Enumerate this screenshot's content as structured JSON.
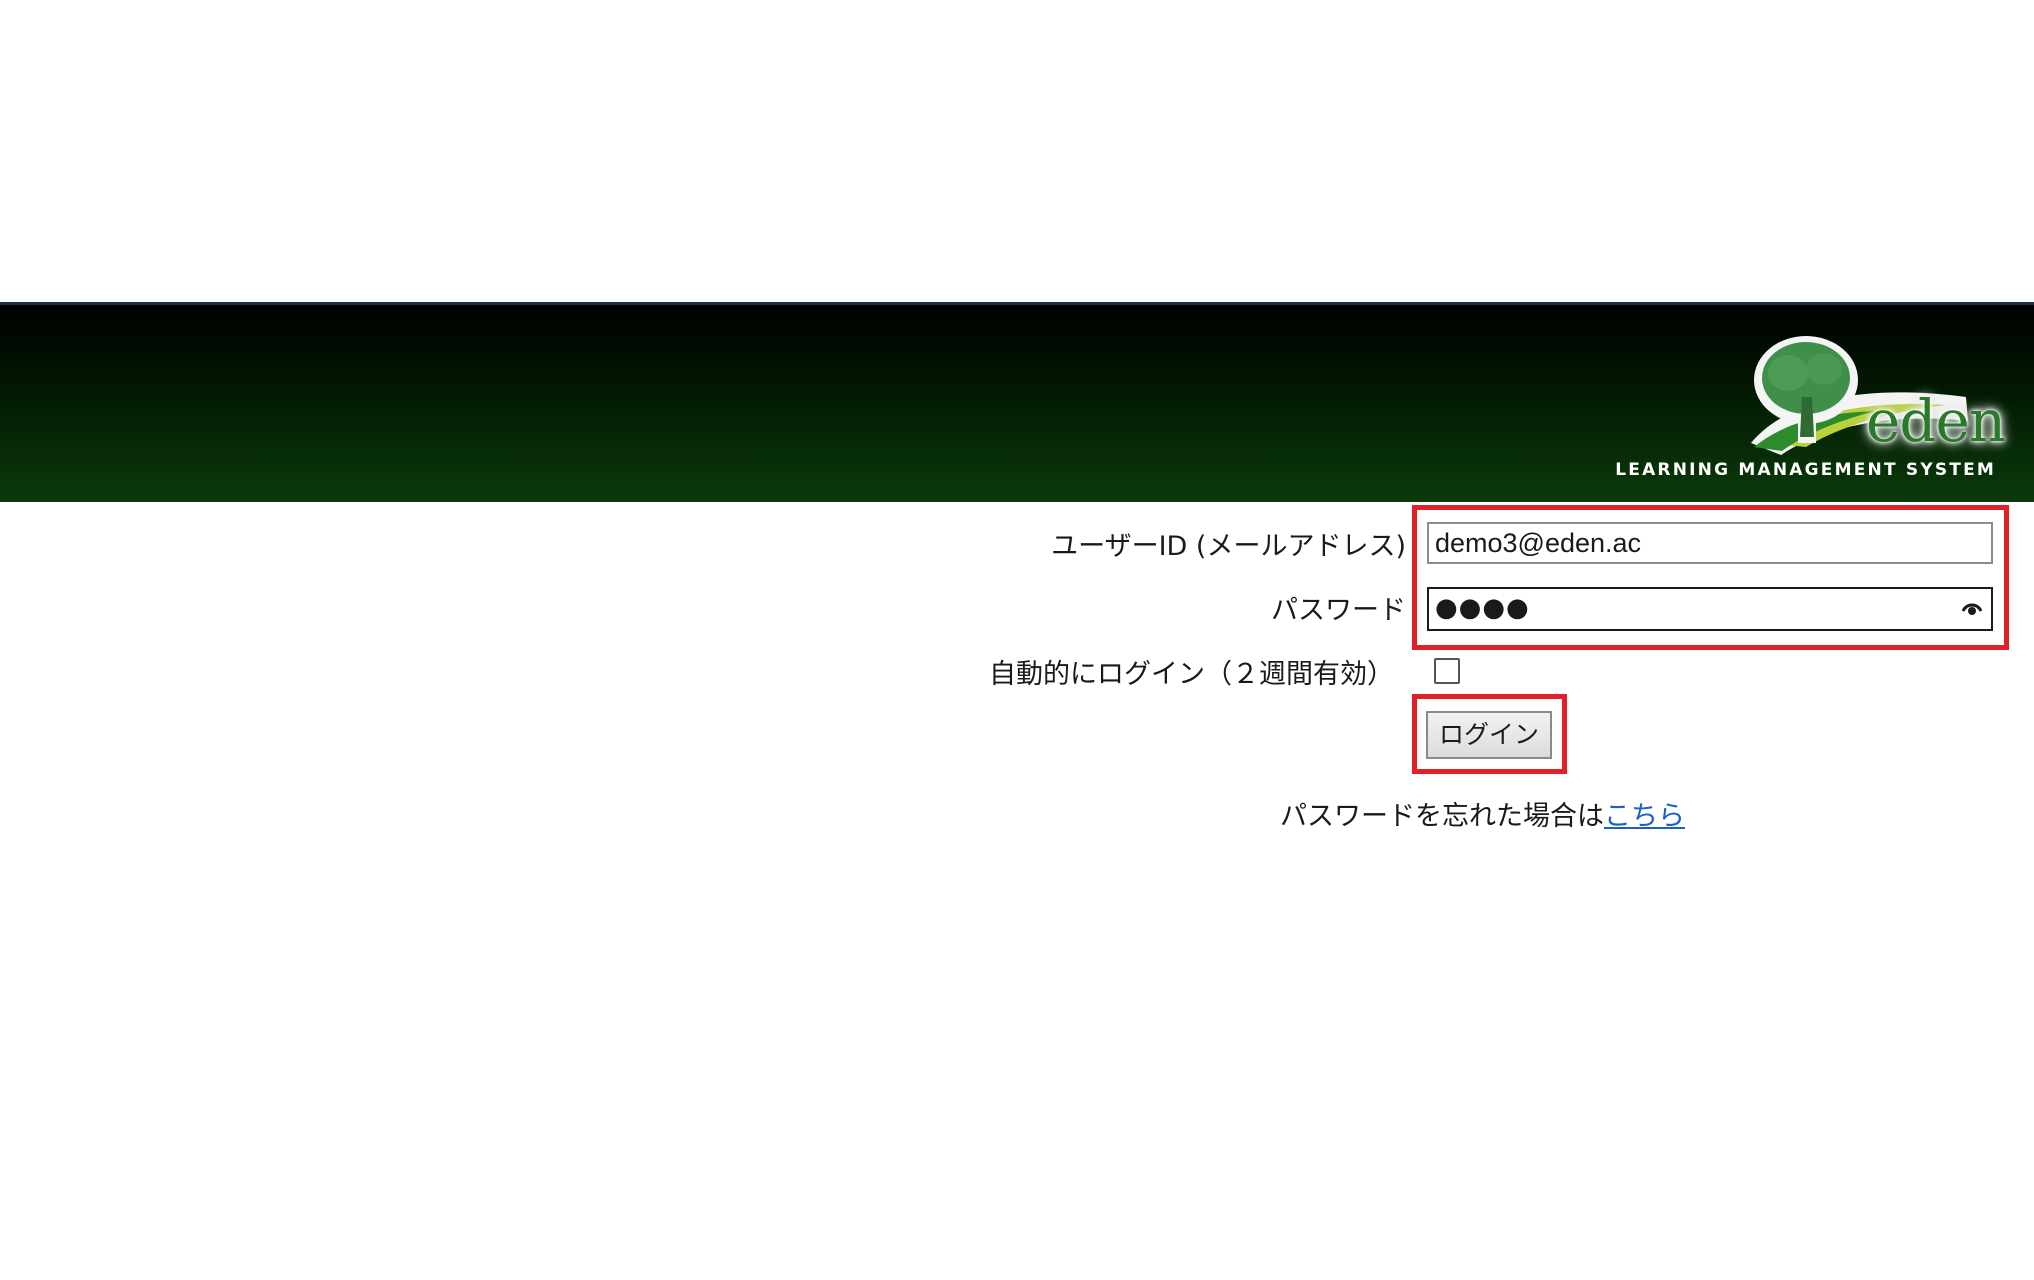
{
  "brand": {
    "logo_word": "eden",
    "tagline": "LEARNING MANAGEMENT SYSTEM",
    "colors": {
      "banner_dark": "#000000",
      "banner_green": "#0b3a0b",
      "logo_green": "#2b7a2b",
      "highlight_red": "#e0202a",
      "link_blue": "#1a5fd0"
    }
  },
  "login_form": {
    "user_id_label": "ユーザーID (メールアドレス)",
    "user_id_value": "demo3@eden.ac",
    "password_label": "パスワード",
    "password_masked": "●●●●",
    "password_reveal_icon": "eye-icon",
    "auto_login_label": "自動的にログイン（２週間有効）",
    "auto_login_checked": false,
    "login_button_label": "ログイン",
    "forgot_text": "パスワードを忘れた場合は",
    "forgot_link": "こちら"
  }
}
